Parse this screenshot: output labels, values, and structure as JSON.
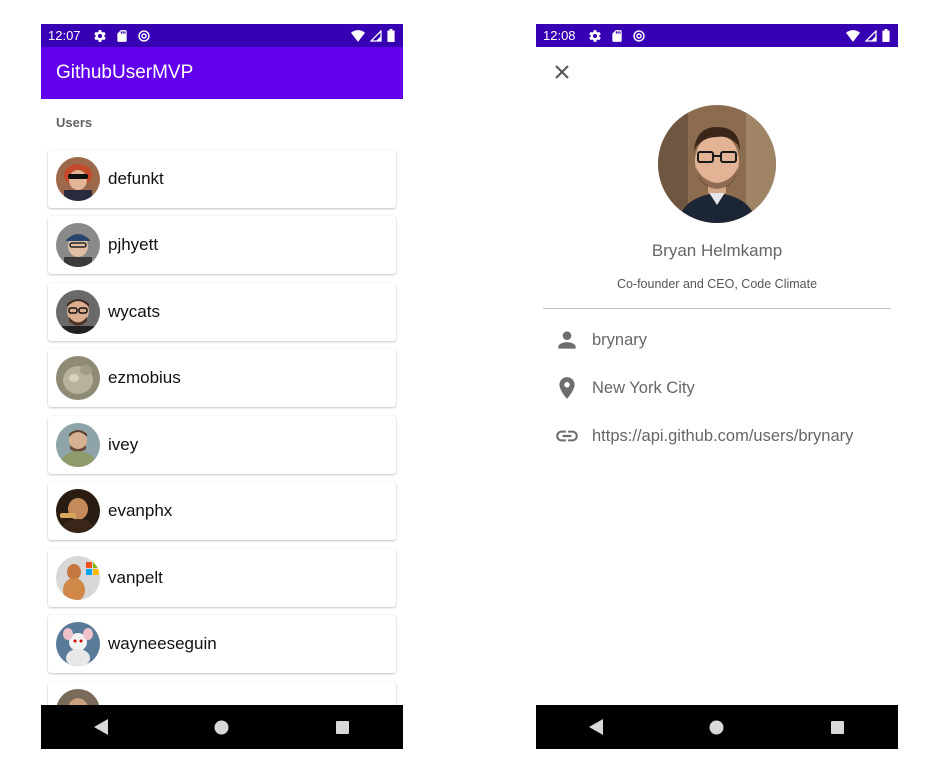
{
  "left_screen": {
    "status_bar": {
      "time": "12:07"
    },
    "app_bar": {
      "title": "GithubUserMVP"
    },
    "section_label": "Users",
    "users": [
      {
        "login": "defunkt"
      },
      {
        "login": "pjhyett"
      },
      {
        "login": "wycats"
      },
      {
        "login": "ezmobius"
      },
      {
        "login": "ivey"
      },
      {
        "login": "evanphx"
      },
      {
        "login": "vanpelt"
      },
      {
        "login": "wayneeseguin"
      },
      {
        "login": ""
      }
    ]
  },
  "right_screen": {
    "status_bar": {
      "time": "12:08"
    },
    "profile": {
      "name": "Bryan Helmkamp",
      "bio": "Co-founder and CEO, Code Climate",
      "username": "brynary",
      "location": "New York City",
      "url": "https://api.github.com/users/brynary"
    },
    "icons": {
      "close": "close-icon",
      "user": "person-icon",
      "location": "location-pin-icon",
      "link": "link-icon"
    }
  },
  "colors": {
    "primary": "#6200EE",
    "primary_dark": "#3700B3",
    "text_secondary": "#666666"
  }
}
